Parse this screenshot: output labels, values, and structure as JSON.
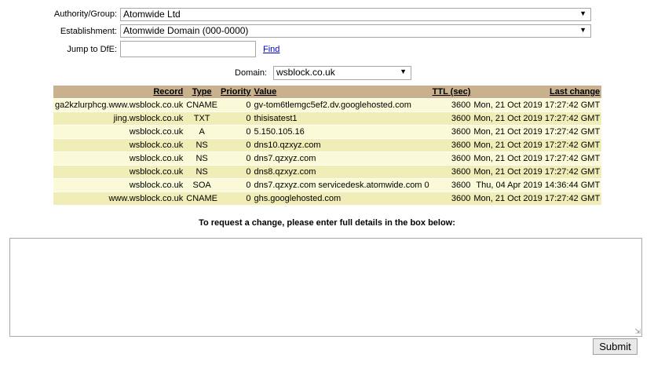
{
  "form": {
    "authority_label": "Authority/Group:",
    "authority_value": "Atomwide Ltd",
    "establishment_label": "Establishment:",
    "establishment_value": "Atomwide Domain (000-0000)",
    "jump_label": "Jump to DfE:",
    "jump_value": "",
    "find_link": "Find",
    "domain_label": "Domain:",
    "domain_value": "wsblock.co.uk"
  },
  "table": {
    "headers": [
      "Record",
      "Type",
      "Priority",
      "Value",
      "TTL (sec)",
      "Last change"
    ],
    "rows": [
      [
        "ga2kzlurphcg.www.wsblock.co.uk",
        "CNAME",
        "0",
        "gv-tom6tlemgc5ef2.dv.googlehosted.com",
        "3600",
        "Mon, 21 Oct 2019 17:27:42 GMT"
      ],
      [
        "jing.wsblock.co.uk",
        "TXT",
        "0",
        "thisisatest1",
        "3600",
        "Mon, 21 Oct 2019 17:27:42 GMT"
      ],
      [
        "wsblock.co.uk",
        "A",
        "0",
        "5.150.105.16",
        "3600",
        "Mon, 21 Oct 2019 17:27:42 GMT"
      ],
      [
        "wsblock.co.uk",
        "NS",
        "0",
        "dns10.qzxyz.com",
        "3600",
        "Mon, 21 Oct 2019 17:27:42 GMT"
      ],
      [
        "wsblock.co.uk",
        "NS",
        "0",
        "dns7.qzxyz.com",
        "3600",
        "Mon, 21 Oct 2019 17:27:42 GMT"
      ],
      [
        "wsblock.co.uk",
        "NS",
        "0",
        "dns8.qzxyz.com",
        "3600",
        "Mon, 21 Oct 2019 17:27:42 GMT"
      ],
      [
        "wsblock.co.uk",
        "SOA",
        "0",
        "dns7.qzxyz.com servicedesk.atomwide.com 0",
        "3600",
        "Thu, 04 Apr 2019 14:36:44 GMT"
      ],
      [
        "www.wsblock.co.uk",
        "CNAME",
        "0",
        "ghs.googlehosted.com",
        "3600",
        "Mon, 21 Oct 2019 17:27:42 GMT"
      ]
    ]
  },
  "request": {
    "instruction": "To request a change, please enter full details in the box below:",
    "details_value": "",
    "submit_label": "Submit"
  },
  "icons": {
    "dropdown": "chevron-down-icon",
    "resize": "resize-grip-icon"
  },
  "colors": {
    "header_bg": "#c9b18e",
    "row_light": "#fafad8",
    "row_dark": "#f0edb6",
    "link": "#0000cc"
  }
}
